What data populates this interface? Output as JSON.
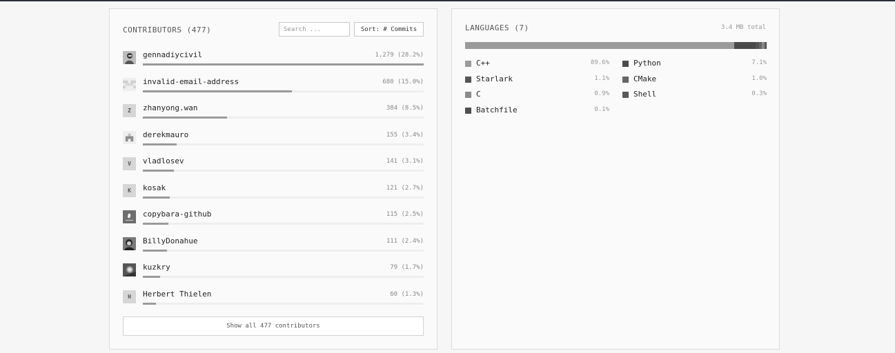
{
  "contributors": {
    "title": "CONTRIBUTORS (477)",
    "search_placeholder": "Search ...",
    "sort_label": "Sort: # Commits",
    "show_all_label": "Show all 477 contributors",
    "items": [
      {
        "name": "gennadiycivil",
        "count": "1,279 (28.2%)",
        "share": 1.0,
        "avatar": "photo-icon",
        "initial": ""
      },
      {
        "name": "invalid-email-address",
        "count": "680 (15.0%)",
        "share": 0.53,
        "avatar": "identicon-icon",
        "initial": ""
      },
      {
        "name": "zhanyong.wan",
        "count": "384 (8.5%)",
        "share": 0.3,
        "avatar": "letter",
        "initial": "Z"
      },
      {
        "name": "derekmauro",
        "count": "155 (3.4%)",
        "share": 0.12,
        "avatar": "identicon-icon",
        "initial": ""
      },
      {
        "name": "vladlosev",
        "count": "141 (3.1%)",
        "share": 0.11,
        "avatar": "letter",
        "initial": "V"
      },
      {
        "name": "kosak",
        "count": "121 (2.7%)",
        "share": 0.095,
        "avatar": "letter",
        "initial": "K"
      },
      {
        "name": "copybara-github",
        "count": "115 (2.5%)",
        "share": 0.09,
        "avatar": "copybara-icon",
        "initial": ""
      },
      {
        "name": "BillyDonahue",
        "count": "111 (2.4%)",
        "share": 0.087,
        "avatar": "photo-icon",
        "initial": ""
      },
      {
        "name": "kuzkry",
        "count": "79 (1.7%)",
        "share": 0.062,
        "avatar": "photo-icon",
        "initial": ""
      },
      {
        "name": "Herbert Thielen",
        "count": "60 (1.3%)",
        "share": 0.047,
        "avatar": "letter",
        "initial": "H"
      }
    ]
  },
  "languages": {
    "title": "LANGUAGES (7)",
    "total": "3.4 MB total",
    "items": [
      {
        "name": "C++",
        "pct": "89.6%",
        "value": 89.6,
        "color": "#9a9a9a"
      },
      {
        "name": "Python",
        "pct": "7.1%",
        "value": 7.1,
        "color": "#4a4a4a"
      },
      {
        "name": "Starlark",
        "pct": "1.1%",
        "value": 1.1,
        "color": "#555555"
      },
      {
        "name": "CMake",
        "pct": "1.0%",
        "value": 1.0,
        "color": "#666666"
      },
      {
        "name": "C",
        "pct": "0.9%",
        "value": 0.9,
        "color": "#8a8a8a"
      },
      {
        "name": "Shell",
        "pct": "0.3%",
        "value": 0.3,
        "color": "#5a5a5a"
      },
      {
        "name": "Batchfile",
        "pct": "0.1%",
        "value": 0.1,
        "color": "#4e4e4e"
      }
    ]
  }
}
